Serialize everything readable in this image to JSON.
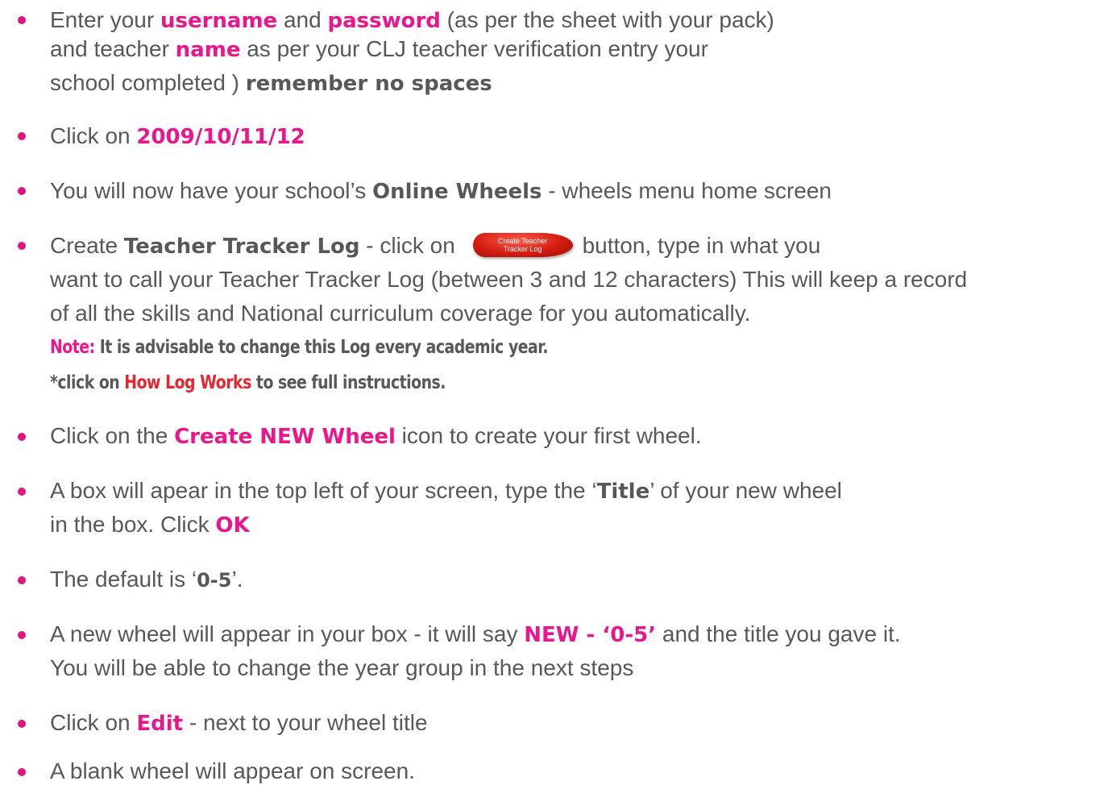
{
  "colors": {
    "bullet": "#e0157f",
    "highlight_pink": "#ec168c",
    "highlight_red": "#e8252f",
    "text_grey": "#58585a",
    "button_red": "#d41d12"
  },
  "bullets": [
    {
      "lines": [
        [
          "Enter your ",
          "username",
          " and ",
          "password",
          " (as per the sheet with your pack)"
        ],
        [
          "and teacher ",
          "name",
          " as per your CLJ teacher verification entry your"
        ],
        [
          "school completed ) ",
          "remember no spaces"
        ]
      ]
    },
    {
      "lines": [
        [
          "Click on ",
          "2009/10/11/12"
        ]
      ]
    },
    {
      "lines": [
        [
          "You will now have your school’s ",
          "Online Wheels",
          " - wheels menu home screen"
        ]
      ]
    },
    {
      "lines": [
        [
          "Create ",
          "Teacher Tracker Log",
          " - click on ",
          "button, type in what you"
        ],
        [
          "want to call your Teacher Tracker Log (between 3 and 12 characters) This will keep a record"
        ],
        [
          "of all the skills and National curriculum coverage for you automatically."
        ]
      ],
      "button": {
        "line1": "Create Teacher",
        "line2": "Tracker Log",
        "icon": "oval-red-button"
      },
      "note": {
        "label": "Note:",
        "text": " It is advisable to change this Log every academic year.",
        "line2_prefix": "*click on ",
        "line2_link": "How Log Works",
        "line2_suffix": " to see full instructions."
      }
    },
    {
      "lines": [
        [
          "Click on the ",
          "Create NEW Wheel",
          " icon to create your first wheel."
        ]
      ]
    },
    {
      "lines": [
        [
          "A box will apear in the top left of your screen, type the ‘",
          "Title",
          "’ of your new wheel"
        ],
        [
          "in the box. Click ",
          "OK"
        ]
      ]
    },
    {
      "lines": [
        [
          "The default is ‘",
          "0-5",
          "’."
        ]
      ]
    },
    {
      "lines": [
        [
          "A new wheel will appear in your box - it will say ",
          "NEW - ‘0-5’",
          " and the title you gave it."
        ],
        [
          "You will be able to change the year group in the next steps"
        ]
      ]
    },
    {
      "lines": [
        [
          "Click on ",
          "Edit",
          " - next to your wheel title"
        ]
      ]
    },
    {
      "lines": [
        [
          "A blank wheel will appear on screen."
        ]
      ]
    }
  ]
}
